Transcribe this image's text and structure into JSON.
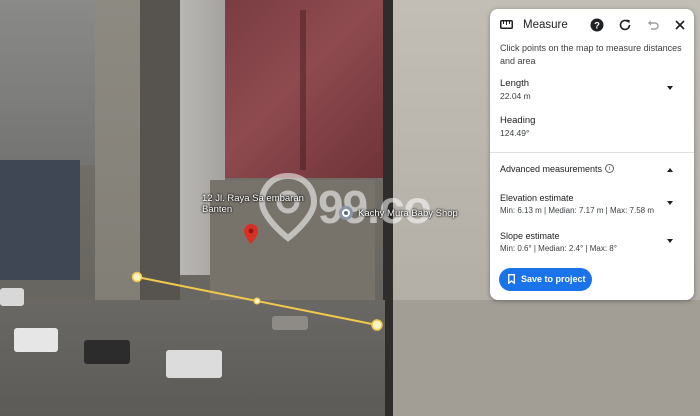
{
  "panel": {
    "title": "Measure",
    "description": "Click points on the map to measure distances and area",
    "length": {
      "label": "Length",
      "value": "22.04 m"
    },
    "heading": {
      "label": "Heading",
      "value": "124.49°"
    },
    "advanced": {
      "label": "Advanced measurements",
      "info": "i"
    },
    "elevation": {
      "label": "Elevation estimate",
      "value": "Min: 6.13 m | Median: 7.17 m | Max: 7.58 m"
    },
    "slope": {
      "label": "Slope estimate",
      "value": "Min: 0.6° | Median: 2.4° | Max: 8°"
    },
    "save_label": "Save to project",
    "icons": [
      "ruler-icon",
      "help-icon",
      "refresh-icon",
      "undo-icon",
      "close-icon",
      "chevron-down-icon",
      "chevron-up-icon",
      "bookmark-icon"
    ]
  },
  "map": {
    "address_label": "12 Jl. Raya Sa embaran Banten",
    "place_label": "Kachy Mura Baby Shop",
    "watermark": "99.co",
    "measure_line_color": "#f2c94c"
  },
  "colors": {
    "accent": "#1a73e8",
    "pin_red": "#d93025"
  }
}
